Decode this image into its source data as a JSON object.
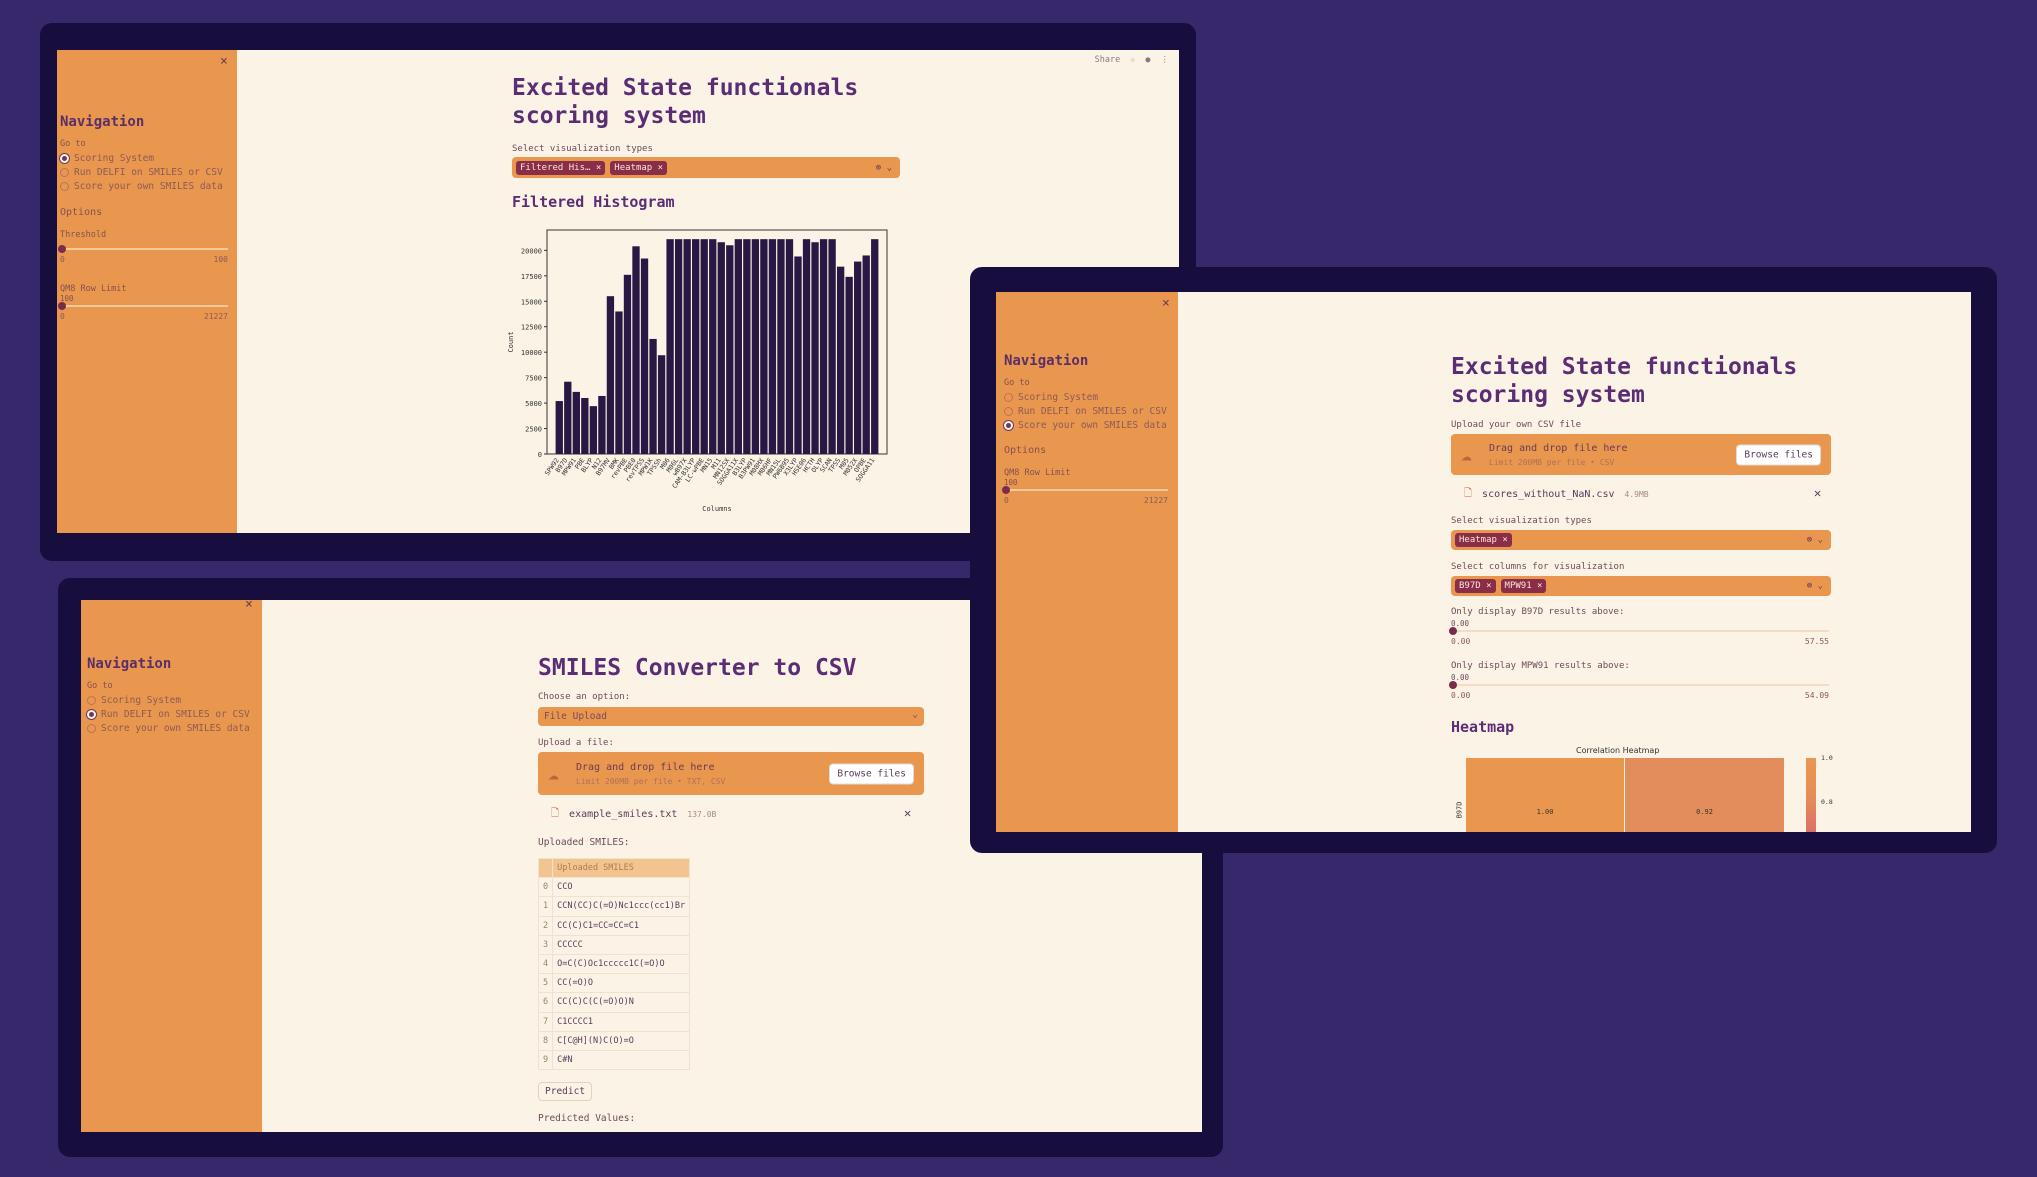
{
  "window1": {
    "sidebar": {
      "close": "×",
      "heading": "Navigation",
      "goto_label": "Go to",
      "nav": [
        {
          "label": "Scoring System",
          "selected": true
        },
        {
          "label": "Run DELFI on SMILES or CSV",
          "selected": false
        },
        {
          "label": "Score your own SMILES data",
          "selected": false
        }
      ],
      "options_label": "Options",
      "threshold_label": "Threshold",
      "threshold_min": "0",
      "threshold_max": "100",
      "qm8_label": "QM8 Row Limit",
      "qm8_value": "100",
      "qm8_min": "0",
      "qm8_max": "21227"
    },
    "topbar": {
      "share": "Share"
    },
    "title_line1": "Excited State functionals",
    "title_line2": "scoring system",
    "viz_label": "Select visualization types",
    "viz_tags": [
      "Filtered His…",
      "Heatmap"
    ],
    "section_title": "Filtered Histogram"
  },
  "chart_data": {
    "type": "bar",
    "title": "",
    "xlabel": "Columns",
    "ylabel": "Count",
    "ylim": [
      0,
      22000
    ],
    "yticks": [
      0,
      2500,
      5000,
      7500,
      10000,
      12500,
      15000,
      17500,
      20000
    ],
    "values": [
      5200,
      7100,
      6100,
      5500,
      4700,
      5700,
      15500,
      14000,
      17600,
      20400,
      19200,
      11300,
      9700,
      21100,
      21100,
      21100,
      21100,
      21100,
      21100,
      20800,
      20500,
      21100,
      21100,
      21100,
      21100,
      21100,
      21100,
      21100,
      19400,
      21100,
      20800,
      21100,
      21100,
      18400,
      17400,
      18900,
      19500,
      21100
    ],
    "categories": [
      "SPW92",
      "B97D",
      "MPW91",
      "PBE",
      "BLYP",
      "N12",
      "B97MV",
      "BMK",
      "revPBE",
      "PBE0",
      "revTPSS",
      "MPW1K",
      "TPSSh",
      "M06",
      "M06L",
      "wB97X",
      "CAM-B3LYP",
      "LC-wPBE",
      "MN15",
      "M11",
      "MN12SX",
      "SOGGA11X",
      "B3LYP",
      "B3PW91",
      "M08HX",
      "M06HF",
      "MN15L",
      "PW6B95",
      "X3LYP",
      "HSE06",
      "HCTH",
      "OLYP",
      "SCAN",
      "TPSS",
      "M05",
      "M052X",
      "OPBE",
      "SOGGA11"
    ]
  },
  "window2": {
    "sidebar": {
      "close": "×",
      "heading": "Navigation",
      "goto_label": "Go to",
      "nav": [
        {
          "label": "Scoring System",
          "selected": false
        },
        {
          "label": "Run DELFI on SMILES or CSV",
          "selected": false
        },
        {
          "label": "Score your own SMILES data",
          "selected": true
        }
      ],
      "options_label": "Options",
      "qm8_label": "QM8 Row Limit",
      "qm8_value": "100",
      "qm8_min": "0",
      "qm8_max": "21227"
    },
    "title_line1": "Excited State functionals",
    "title_line2": "scoring system",
    "upload_label": "Upload your own CSV file",
    "upload_main": "Drag and drop file here",
    "upload_limit": "Limit 200MB per file • CSV",
    "browse": "Browse files",
    "file_name": "scores_without_NaN.csv",
    "file_size": "4.9MB",
    "viz_label": "Select visualization types",
    "viz_tags": [
      "Heatmap"
    ],
    "cols_label": "Select columns for visualization",
    "cols_tags": [
      "B97D",
      "MPW91"
    ],
    "b97d_label": "Only display B97D results above:",
    "b97d_value": "0.00",
    "b97d_min": "0.00",
    "b97d_max": "57.55",
    "mpw91_label": "Only display MPW91 results above:",
    "mpw91_value": "0.00",
    "mpw91_min": "0.00",
    "mpw91_max": "54.09",
    "section_title": "Heatmap",
    "heatmap": {
      "title": "Correlation Heatmap",
      "ylabel": "B97D",
      "cells": [
        "1.00",
        "0.92"
      ],
      "colorbar_ticks": [
        "1.0",
        "0.8"
      ]
    }
  },
  "window3": {
    "sidebar": {
      "close": "×",
      "heading": "Navigation",
      "goto_label": "Go to",
      "nav": [
        {
          "label": "Scoring System",
          "selected": false
        },
        {
          "label": "Run DELFI on SMILES or CSV",
          "selected": true
        },
        {
          "label": "Score your own SMILES data",
          "selected": false
        }
      ]
    },
    "title": "SMILES Converter to CSV",
    "choose_label": "Choose an option:",
    "choose_value": "File Upload",
    "upload_label": "Upload a file:",
    "upload_main": "Drag and drop file here",
    "upload_limit": "Limit 200MB per file • TXT, CSV",
    "browse": "Browse files",
    "file_name": "example_smiles.txt",
    "file_size": "137.0B",
    "uploaded_label": "Uploaded SMILES:",
    "table_header": "Uploaded SMILES",
    "rows": [
      "CCO",
      "CCN(CC)C(=O)Nc1ccc(cc1)Br",
      "CC(C)C1=CC=CC=C1",
      "CCCCC",
      "O=C(C)Oc1ccccc1C(=O)O",
      "CC(=O)O",
      "CC(C)C(C(=O)O)N",
      "C1CCCC1",
      "C[C@H](N)C(O)=O",
      "C#N"
    ],
    "predict": "Predict",
    "predicted_label": "Predicted Values:"
  }
}
